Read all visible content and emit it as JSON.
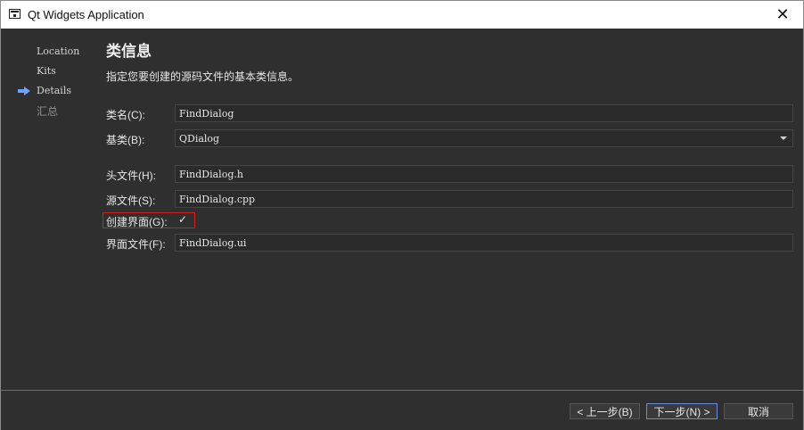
{
  "window": {
    "title": "Qt Widgets Application",
    "close_glyph": "✕"
  },
  "sidebar": {
    "items": [
      {
        "label": "Location"
      },
      {
        "label": "Kits"
      },
      {
        "label": "Details"
      },
      {
        "label": "汇总"
      }
    ]
  },
  "page": {
    "title": "类信息",
    "subtitle": "指定您要创建的源码文件的基本类信息。"
  },
  "form": {
    "class_name_label": "类名(C):",
    "class_name_value": "FindDialog",
    "base_class_label": "基类(B):",
    "base_class_value": "QDialog",
    "header_label": "头文件(H):",
    "header_value": "FindDialog.h",
    "source_label": "源文件(S):",
    "source_value": "FindDialog.cpp",
    "create_ui_label": "创建界面(G):",
    "create_ui_mark": "✓",
    "ui_file_label": "界面文件(F):",
    "ui_file_value": "FindDialog.ui"
  },
  "buttons": {
    "back": "< 上一步(B)",
    "next": "下一步(N) >",
    "cancel": "取消"
  }
}
